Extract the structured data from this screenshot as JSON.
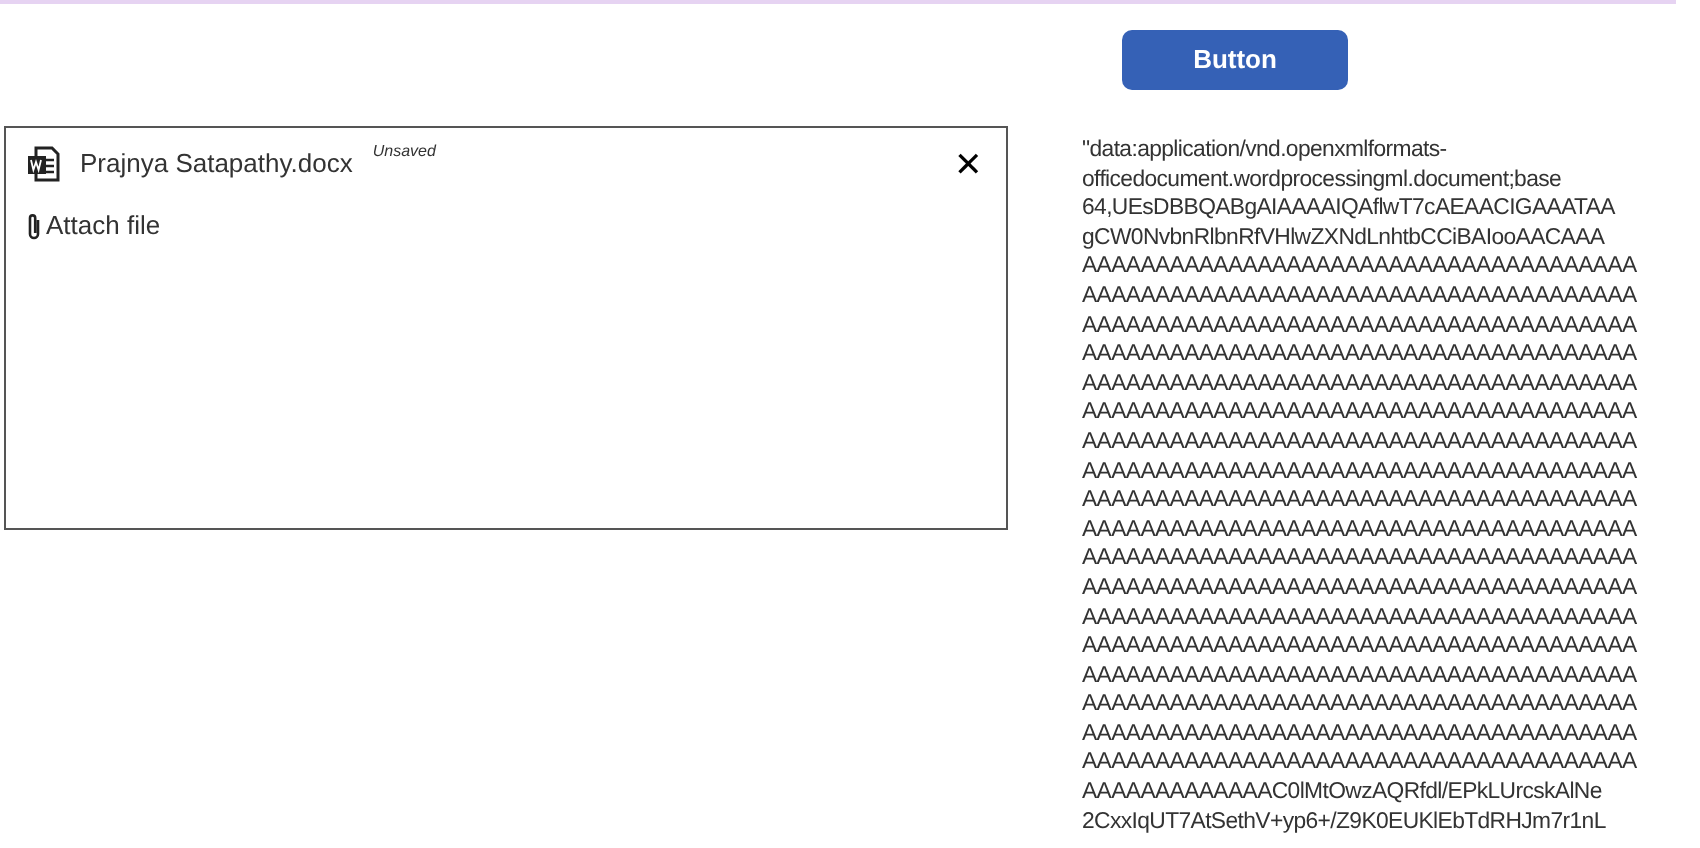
{
  "button": {
    "label": "Button"
  },
  "attachment": {
    "file_name": "Prajnya Satapathy.docx",
    "status": "Unsaved",
    "close": "✕",
    "attach_label": "Attach file"
  },
  "output_text": {
    "lines": [
      "\"data:application/vnd.openxmlformats-",
      "officedocument.wordprocessingml.document;base",
      "64,UEsDBBQABgAIAAAAIQAflwT7cAEAACIGAAATAA",
      "gCW0NvbnRlbnRfVHlwZXNdLnhtbCCiBAIooAACAAA",
      "AAAAAAAAAAAAAAAAAAAAAAAAAAAAAAAAAAAAAA",
      "AAAAAAAAAAAAAAAAAAAAAAAAAAAAAAAAAAAAAA",
      "AAAAAAAAAAAAAAAAAAAAAAAAAAAAAAAAAAAAAA",
      "AAAAAAAAAAAAAAAAAAAAAAAAAAAAAAAAAAAAAA",
      "AAAAAAAAAAAAAAAAAAAAAAAAAAAAAAAAAAAAAA",
      "AAAAAAAAAAAAAAAAAAAAAAAAAAAAAAAAAAAAAA",
      "AAAAAAAAAAAAAAAAAAAAAAAAAAAAAAAAAAAAAA",
      "AAAAAAAAAAAAAAAAAAAAAAAAAAAAAAAAAAAAAA",
      "AAAAAAAAAAAAAAAAAAAAAAAAAAAAAAAAAAAAAA",
      "AAAAAAAAAAAAAAAAAAAAAAAAAAAAAAAAAAAAAA",
      "AAAAAAAAAAAAAAAAAAAAAAAAAAAAAAAAAAAAAA",
      "AAAAAAAAAAAAAAAAAAAAAAAAAAAAAAAAAAAAAA",
      "AAAAAAAAAAAAAAAAAAAAAAAAAAAAAAAAAAAAAA",
      "AAAAAAAAAAAAAAAAAAAAAAAAAAAAAAAAAAAAAA",
      "AAAAAAAAAAAAAAAAAAAAAAAAAAAAAAAAAAAAAA",
      "AAAAAAAAAAAAAAAAAAAAAAAAAAAAAAAAAAAAAA",
      "AAAAAAAAAAAAAAAAAAAAAAAAAAAAAAAAAAAAAA",
      "AAAAAAAAAAAAAAAAAAAAAAAAAAAAAAAAAAAAAA",
      "AAAAAAAAAAAAAC0lMtOwzAQRfdl/EPkLUrcskAlNe",
      "2CxxIqUT7AtSethV+yp6+/Z9K0EUKlEbTdRHJm7r1nL"
    ]
  }
}
